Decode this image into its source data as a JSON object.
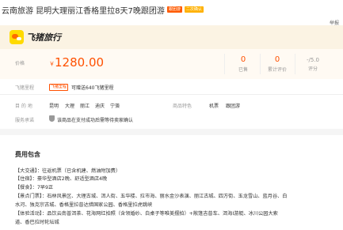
{
  "header": {
    "title": "云南旅游 昆明大理丽江香格里拉8天7晚跟团游",
    "tag_primary": "跟团游",
    "tag_secondary": "二次确认",
    "report": "举报"
  },
  "brand": {
    "name": "飞猪旅行"
  },
  "price": {
    "label": "价格",
    "currency": "￥",
    "value": "1280.00",
    "sold": {
      "num": "0",
      "caption": "已售"
    },
    "reviews": {
      "num": "0",
      "caption": "累计评价"
    },
    "rating": {
      "num": "-/5.0",
      "caption": "评分"
    }
  },
  "member": {
    "label": "飞猪里程",
    "tag": "飞猪里程",
    "text": "可赠送640飞猪里程"
  },
  "attributes": {
    "dest_label": "目 的 地",
    "dest": [
      "昆明",
      "大理",
      "丽江",
      "迪庆",
      "宁蒗"
    ],
    "feature_label": "商品特色",
    "features": [
      "机票",
      "跟团游"
    ],
    "service_label": "服务承诺",
    "service_text": "该商品在支付成功后需等待卖家确认"
  },
  "fees": {
    "title": "费用包含",
    "lines": [
      "【大交通】：往返机票（已含机建、燃油附加费）",
      "【住宿】：豪华型酒店2晚、舒适型酒店4晚",
      "【餐食】：7早9正",
      "【景点门票】：石林风景区、大理古城、洱人街、五华楼、拉市海、丽水金沙表演、丽江古城、四方街、玉龙雪山、蓝月谷、白",
      "水河、独克宗古城、香格里拉普达措国家公园、香格里拉虎跳峡",
      "【体验活动】：品饮云南普洱茶、花海网红拍照（含领婚纱、白桌子等唯美摆拍）+敞篷吉普车、洱海Ⅰ游艇、冰川公园大索",
      "道、香巴拉时轮坛城"
    ]
  }
}
